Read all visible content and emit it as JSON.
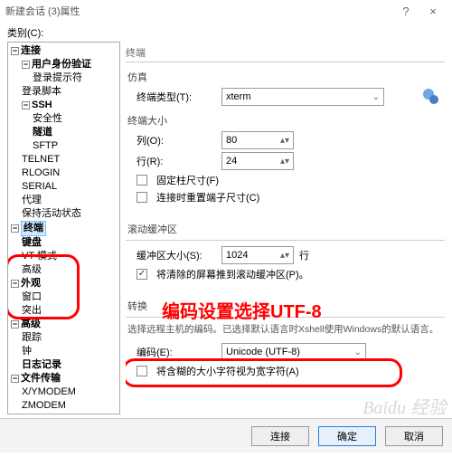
{
  "window": {
    "title": "新建会话 (3)属性",
    "help": "?",
    "close": "×"
  },
  "category_label": "类别(C):",
  "tree": {
    "conn": "连接",
    "auth": "用户身份验证",
    "login_prompt": "登录提示符",
    "login_script": "登录脚本",
    "ssh": "SSH",
    "security": "安全性",
    "tunnel": "隧道",
    "sftp": "SFTP",
    "telnet": "TELNET",
    "rlogin": "RLOGIN",
    "serial": "SERIAL",
    "proxy": "代理",
    "keepalive": "保持活动状态",
    "terminal": "终端",
    "keyboard": "键盘",
    "vtmode": "VT 模式",
    "advanced_t": "高级",
    "appearance": "外观",
    "window": "窗口",
    "highlight": "突出",
    "adv": "高级",
    "trace": "跟踪",
    "bell": "钟",
    "logging": "日志记录",
    "file": "文件传输",
    "xymodem": "X/YMODEM",
    "zmodem": "ZMODEM"
  },
  "right": {
    "header": "终端",
    "sim": "仿真",
    "term_type_label": "终端类型(T):",
    "term_type_value": "xterm",
    "size": "终端大小",
    "cols_label": "列(O):",
    "cols_value": "80",
    "rows_label": "行(R):",
    "rows_value": "24",
    "fixed_cols": "固定柱尺寸(F)",
    "adjust_on_connect": "连接时重置端子尺寸(C)",
    "scroll": "滚动缓冲区",
    "buffer_label": "缓冲区大小(S):",
    "buffer_value": "1024",
    "buffer_unit": "行",
    "push_clear": "将清除的屏幕推到滚动缓冲区(P)。",
    "convert": "转换",
    "convert_desc": "选择远程主机的编码。已选择默认语言时Xshell使用Windows的默认语言。",
    "encoding_label": "编码(E):",
    "encoding_value": "Unicode (UTF-8)",
    "halfwidth": "将含糊的大小字符视为宽字符(A)"
  },
  "annotation": "编码设置选择UTF-8",
  "footer": {
    "connect": "连接",
    "ok": "确定",
    "cancel": "取消"
  },
  "watermark": "Baidu 经验"
}
